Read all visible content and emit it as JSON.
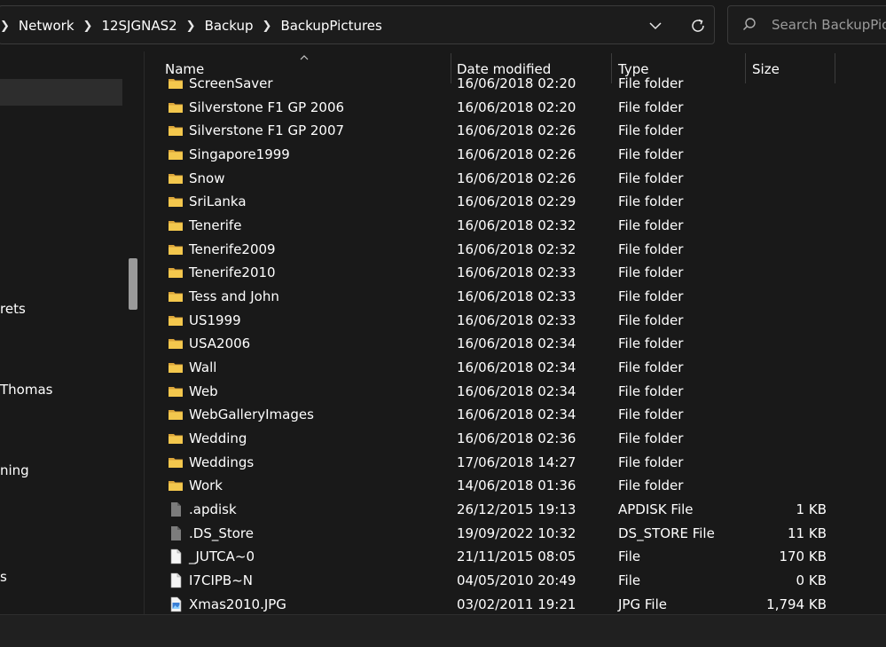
{
  "address_bar": {
    "breadcrumbs": [
      "Network",
      "12SJGNAS2",
      "Backup",
      "BackupPictures"
    ]
  },
  "search": {
    "placeholder": "Search BackupPictures"
  },
  "nav_pane": {
    "items": [
      {
        "label": "rets"
      },
      {
        "label": "Thomas"
      },
      {
        "label": "ning"
      },
      {
        "label": "s"
      }
    ]
  },
  "columns": {
    "name": "Name",
    "date": "Date modified",
    "type": "Type",
    "size": "Size"
  },
  "files": [
    {
      "name": "ScreenSaver",
      "date": "16/06/2018 02:20",
      "type": "File folder",
      "size": "",
      "icon": "folder-icon"
    },
    {
      "name": "Silverstone F1 GP 2006",
      "date": "16/06/2018 02:20",
      "type": "File folder",
      "size": "",
      "icon": "folder-icon"
    },
    {
      "name": "Silverstone F1 GP 2007",
      "date": "16/06/2018 02:26",
      "type": "File folder",
      "size": "",
      "icon": "folder-icon"
    },
    {
      "name": "Singapore1999",
      "date": "16/06/2018 02:26",
      "type": "File folder",
      "size": "",
      "icon": "folder-icon"
    },
    {
      "name": "Snow",
      "date": "16/06/2018 02:26",
      "type": "File folder",
      "size": "",
      "icon": "folder-icon"
    },
    {
      "name": "SriLanka",
      "date": "16/06/2018 02:29",
      "type": "File folder",
      "size": "",
      "icon": "folder-icon"
    },
    {
      "name": "Tenerife",
      "date": "16/06/2018 02:32",
      "type": "File folder",
      "size": "",
      "icon": "folder-icon"
    },
    {
      "name": "Tenerife2009",
      "date": "16/06/2018 02:32",
      "type": "File folder",
      "size": "",
      "icon": "folder-icon"
    },
    {
      "name": "Tenerife2010",
      "date": "16/06/2018 02:33",
      "type": "File folder",
      "size": "",
      "icon": "folder-icon"
    },
    {
      "name": "Tess and John",
      "date": "16/06/2018 02:33",
      "type": "File folder",
      "size": "",
      "icon": "folder-icon"
    },
    {
      "name": "US1999",
      "date": "16/06/2018 02:33",
      "type": "File folder",
      "size": "",
      "icon": "folder-icon"
    },
    {
      "name": "USA2006",
      "date": "16/06/2018 02:34",
      "type": "File folder",
      "size": "",
      "icon": "folder-icon"
    },
    {
      "name": "Wall",
      "date": "16/06/2018 02:34",
      "type": "File folder",
      "size": "",
      "icon": "folder-icon"
    },
    {
      "name": "Web",
      "date": "16/06/2018 02:34",
      "type": "File folder",
      "size": "",
      "icon": "folder-icon"
    },
    {
      "name": "WebGalleryImages",
      "date": "16/06/2018 02:34",
      "type": "File folder",
      "size": "",
      "icon": "folder-icon"
    },
    {
      "name": "Wedding",
      "date": "16/06/2018 02:36",
      "type": "File folder",
      "size": "",
      "icon": "folder-icon"
    },
    {
      "name": "Weddings",
      "date": "17/06/2018 14:27",
      "type": "File folder",
      "size": "",
      "icon": "folder-icon"
    },
    {
      "name": "Work",
      "date": "14/06/2018 01:36",
      "type": "File folder",
      "size": "",
      "icon": "folder-icon"
    },
    {
      "name": ".apdisk",
      "date": "26/12/2015 19:13",
      "type": "APDISK File",
      "size": "1 KB",
      "icon": "file-gray-icon"
    },
    {
      "name": ".DS_Store",
      "date": "19/09/2022 10:32",
      "type": "DS_STORE File",
      "size": "11 KB",
      "icon": "file-gray-icon"
    },
    {
      "name": "_JUTCA~0",
      "date": "21/11/2015 08:05",
      "type": "File",
      "size": "170 KB",
      "icon": "file-white-icon"
    },
    {
      "name": "I7CIPB~N",
      "date": "04/05/2010 20:49",
      "type": "File",
      "size": "0 KB",
      "icon": "file-white-icon"
    },
    {
      "name": "Xmas2010.JPG",
      "date": "03/02/2011 19:21",
      "type": "JPG File",
      "size": "1,794 KB",
      "icon": "image-file-icon"
    }
  ],
  "colors": {
    "background": "#191919",
    "folder": "#f3c74d",
    "file_gray": "#7c7c7c",
    "image_accent": "#3a7fd6"
  }
}
